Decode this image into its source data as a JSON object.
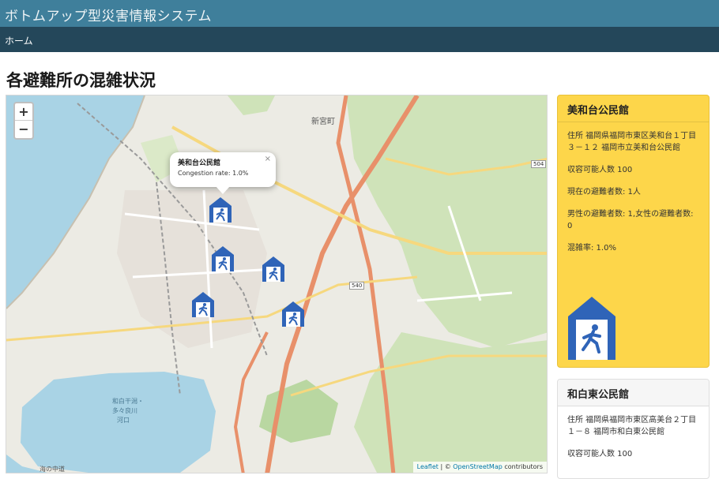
{
  "app": {
    "title": "ボトムアップ型災害情報システム"
  },
  "nav": {
    "home": "ホーム"
  },
  "page": {
    "heading": "各避難所の混雑状況"
  },
  "map": {
    "zoom_in": "+",
    "zoom_out": "−",
    "labels": {
      "shinguumachi": "新宮町",
      "wajiro_bay": "和白干潟・",
      "wajiro_bay2": "多々良川",
      "wajiro_bay3": "河口",
      "road_504": "504",
      "road_540": "540",
      "umi_no_nakamichi": "海の中道"
    },
    "popup": {
      "title": "美和台公民館",
      "rate": "Congestion rate: 1.0%",
      "close": "×"
    },
    "attribution": {
      "leaflet": "Leaflet",
      "separator": " | © ",
      "osm": "OpenStreetMap",
      "contributors": " contributors"
    },
    "marker_icon": "shelter-running-person-icon"
  },
  "cards": [
    {
      "title": "美和台公民館",
      "address": "住所 福岡県福岡市東区美和台１丁目３－１２ 福岡市立美和台公民館",
      "capacity": "収容可能人数 100",
      "current": "現在の避難者数: 1人",
      "gender": "男性の避難者数: 1,女性の避難者数: 0",
      "rate": "混雑率: 1.0%"
    },
    {
      "title": "和白東公民館",
      "address": "住所 福岡県福岡市東区高美台２丁目１－８ 福岡市和白東公民館",
      "capacity": "収容可能人数 100"
    }
  ],
  "colors": {
    "header": "#3f7f9b",
    "nav": "#24475a",
    "card_active": "#fdd64a",
    "marker": "#2f64b8"
  }
}
